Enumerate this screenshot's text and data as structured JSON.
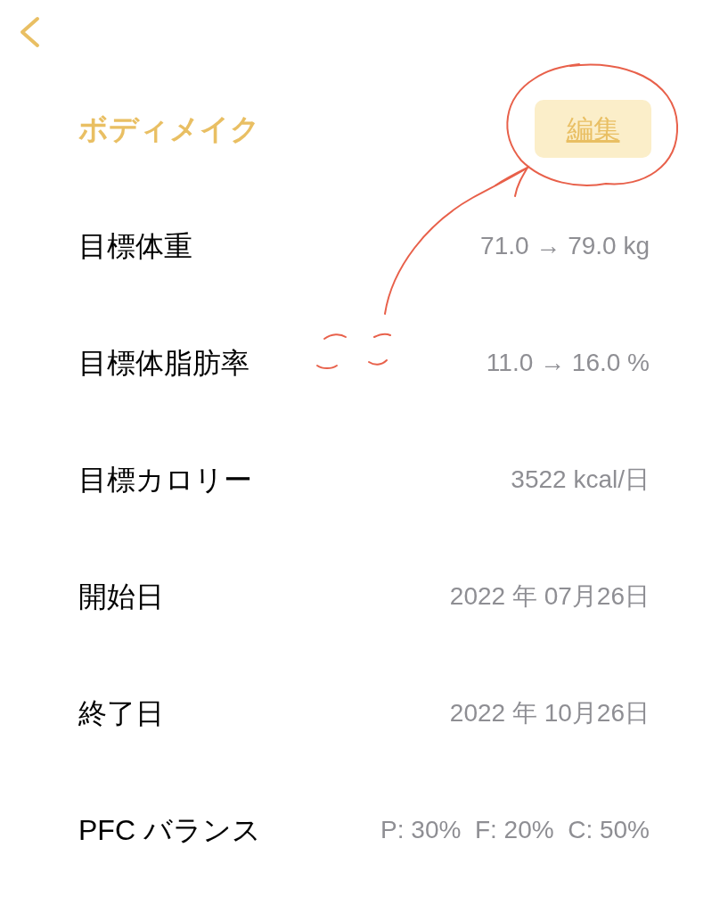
{
  "header": {
    "title": "ボディメイク",
    "edit_button": "編集"
  },
  "rows": [
    {
      "label": "目標体重",
      "value": "71.0 → 79.0 kg"
    },
    {
      "label": "目標体脂肪率",
      "value": "11.0 → 16.0 %"
    },
    {
      "label": "目標カロリー",
      "value": "3522 kcal/日"
    },
    {
      "label": "開始日",
      "value": "2022 年 07月26日"
    },
    {
      "label": "終了日",
      "value": "2022 年 10月26日"
    },
    {
      "label": "PFC バランス",
      "value": "P: 30%  F: 20%  C: 50%"
    }
  ]
}
